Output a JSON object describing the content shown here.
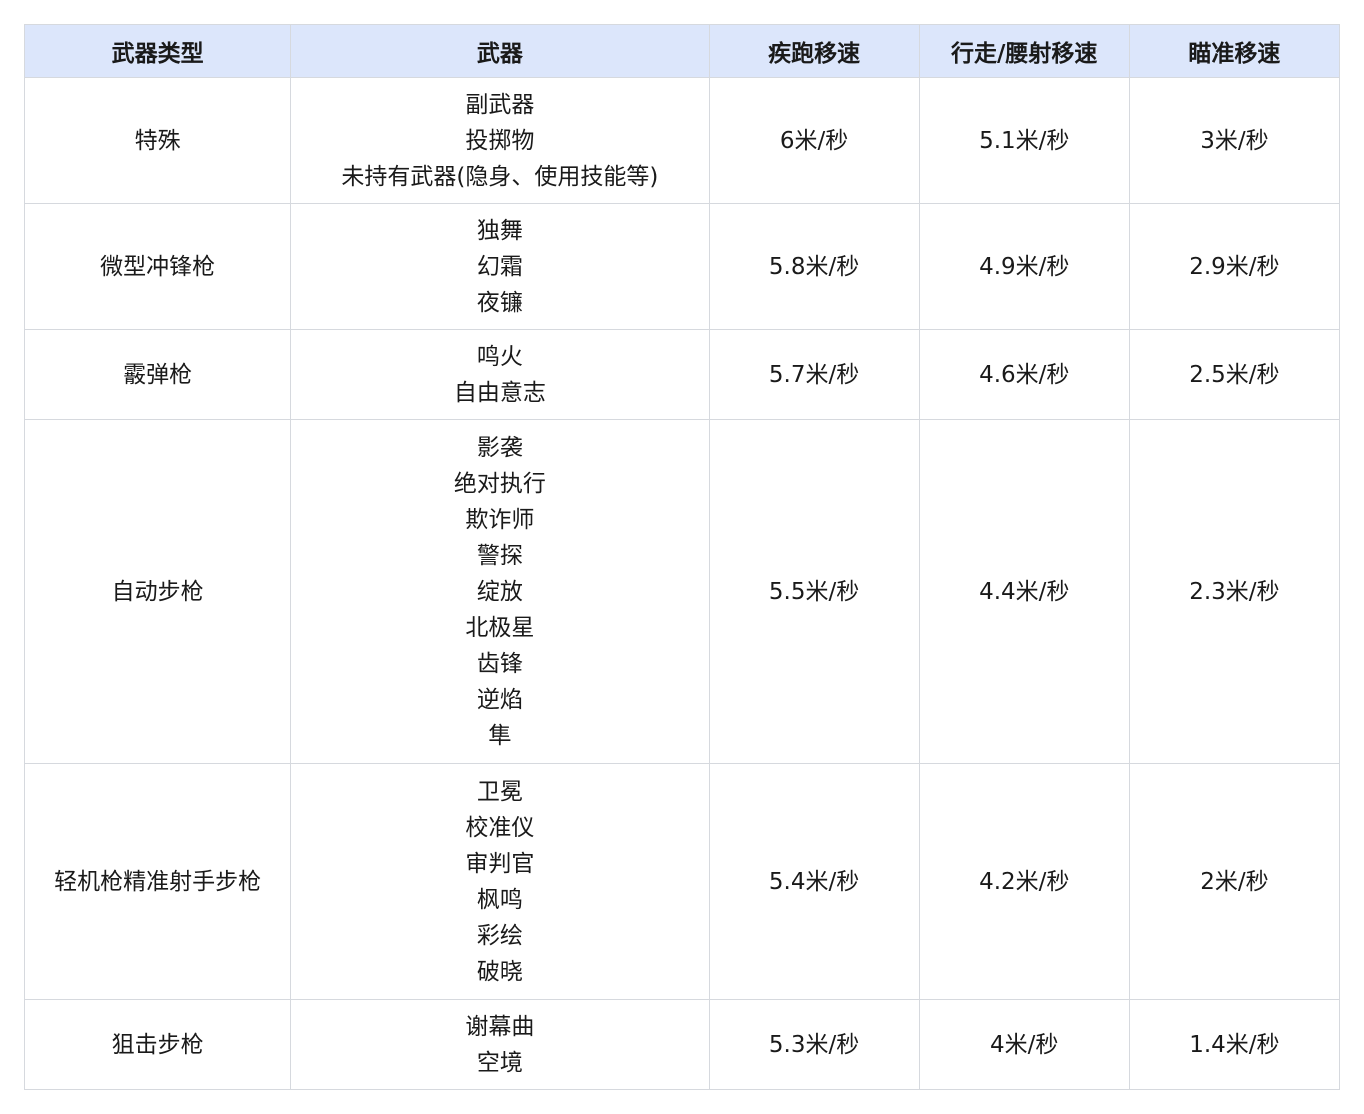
{
  "table": {
    "headers": [
      "武器类型",
      "武器",
      "疾跑移速",
      "行走/腰射移速",
      "瞄准移速"
    ],
    "rows": [
      {
        "type": "特殊",
        "weapons": [
          "副武器",
          "投掷物",
          "未持有武器(隐身、使用技能等)"
        ],
        "sprint": "6米/秒",
        "walk": "5.1米/秒",
        "aim": "3米/秒"
      },
      {
        "type": "微型冲锋枪",
        "weapons": [
          "独舞",
          "幻霜",
          "夜镰"
        ],
        "sprint": "5.8米/秒",
        "walk": "4.9米/秒",
        "aim": "2.9米/秒"
      },
      {
        "type": "霰弹枪",
        "weapons": [
          "鸣火",
          "自由意志"
        ],
        "sprint": "5.7米/秒",
        "walk": "4.6米/秒",
        "aim": "2.5米/秒"
      },
      {
        "type": "自动步枪",
        "weapons": [
          "影袭",
          "绝对执行",
          "欺诈师",
          "警探",
          "绽放",
          "北极星",
          "齿锋",
          "逆焰",
          "隼"
        ],
        "sprint": "5.5米/秒",
        "walk": "4.4米/秒",
        "aim": "2.3米/秒"
      },
      {
        "type": "轻机枪精准射手步枪",
        "weapons": [
          "卫冕",
          "校准仪",
          "审判官",
          "枫鸣",
          "彩绘",
          "破晓"
        ],
        "sprint": "5.4米/秒",
        "walk": "4.2米/秒",
        "aim": "2米/秒"
      },
      {
        "type": "狙击步枪",
        "weapons": [
          "谢幕曲",
          "空境"
        ],
        "sprint": "5.3米/秒",
        "walk": "4米/秒",
        "aim": "1.4米/秒"
      }
    ]
  }
}
